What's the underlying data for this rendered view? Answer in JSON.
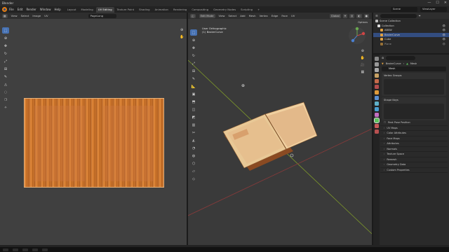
{
  "window": {
    "title": "Blender",
    "controls": [
      "—",
      "☐",
      "✕"
    ]
  },
  "menubar": {
    "menu": [
      "File",
      "Edit",
      "Render",
      "Window",
      "Help"
    ],
    "workspaces": [
      "Layout",
      "Modeling",
      "UV Editing",
      "Texture Paint",
      "Shading",
      "Animation",
      "Rendering",
      "Compositing",
      "Geometry Nodes",
      "Scripting",
      "+"
    ],
    "active_workspace": "UV Editing",
    "scene": "Scene",
    "view_layer": "ViewLayer"
  },
  "uv_editor": {
    "header": [
      "View",
      "Select",
      "Image",
      "UV"
    ],
    "image_name": "PageLong",
    "toolbar_icons": [
      "select-icon",
      "cursor-icon",
      "move-icon",
      "rotate-icon",
      "scale-icon",
      "transform-icon",
      "annotate-icon",
      "rip-icon",
      "grab-icon",
      "relax-icon",
      "pinch-icon"
    ]
  },
  "viewport": {
    "mode": "Edit Mode",
    "header": [
      "View",
      "Select",
      "Add",
      "Mesh",
      "Vertex",
      "Edge",
      "Face",
      "UV"
    ],
    "pivot": "Global",
    "info_line1": "User Orthographic",
    "info_line2": "(1) BezierCurve",
    "options": "Options",
    "accent": "#e87d0d"
  },
  "outliner": {
    "rows": [
      {
        "label": "Scene Collection",
        "selected": false,
        "color": "#cccccc"
      },
      {
        "label": "Collection",
        "selected": false,
        "color": "#cccccc"
      },
      {
        "label": "ABSW",
        "selected": false,
        "color": "#e0a040"
      },
      {
        "label": "BezierCurve",
        "selected": true,
        "color": "#e0a040"
      },
      {
        "label": "Cube",
        "selected": false,
        "color": "#e0a040"
      },
      {
        "label": "Plane",
        "selected": false,
        "color": "#e0a040"
      }
    ]
  },
  "properties": {
    "breadcrumb": [
      "BezierCurve",
      "Mesh"
    ],
    "mesh_name": "Mesh",
    "panels": [
      "Vertex Groups",
      "Shape Keys"
    ],
    "sections": [
      "UV Maps",
      "Color Attributes",
      "Face Maps",
      "Attributes",
      "Normals",
      "Texture Space",
      "Remesh",
      "Geometry Data",
      "Custom Properties"
    ],
    "checkbox": "Rest Pose Position"
  }
}
